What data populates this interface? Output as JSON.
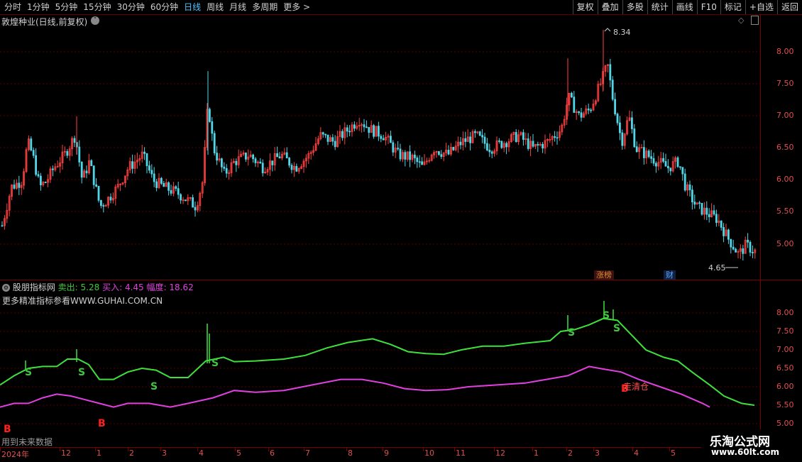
{
  "toolbar": {
    "periods": [
      "分时",
      "1分钟",
      "5分钟",
      "15分钟",
      "30分钟",
      "60分钟",
      "日线",
      "周线",
      "月线",
      "多周期",
      "更多 >"
    ],
    "active_period": "日线",
    "tools": [
      "复权",
      "叠加",
      "多股",
      "统计",
      "画线",
      "F10",
      "标记",
      "+自选",
      "返回"
    ]
  },
  "stock": {
    "title": "敦煌种业(日线,前复权)",
    "peak_label": "8.34",
    "low_label": "4.65",
    "price_axis": [
      "8.00",
      "7.50",
      "7.00",
      "6.50",
      "6.00",
      "5.50",
      "5.00"
    ],
    "badges": {
      "zhangbang": "涨榜",
      "cai": "财"
    }
  },
  "indicator": {
    "name": "股朋指标网",
    "sell_label": "卖出:",
    "sell_value": "5.28",
    "buy_label": "买入:",
    "buy_value": "4.45",
    "amp_label": "幅度:",
    "amp_value": "18.62",
    "note": "更多精准指标参看WWW.GUHAI.COM.CN",
    "axis": [
      "8.00",
      "7.50",
      "7.00",
      "6.50",
      "6.00",
      "5.50",
      "5.00"
    ],
    "signal_s": "S",
    "signal_b": "B",
    "clear_label": "走清仓",
    "future_note": "用到未来数据"
  },
  "date_axis": [
    "2024年",
    "12",
    "1",
    "2",
    "3",
    "4",
    "5",
    "6",
    "7",
    "8",
    "9",
    "10",
    "11",
    "12",
    "1",
    "2",
    "3",
    "4",
    "5"
  ],
  "watermark": {
    "line1": "乐淘公式网",
    "line2": "www.60lt.com"
  },
  "colors": {
    "up": "#ff4040",
    "down": "#4fd7e8",
    "sell_line": "#3ee03e",
    "buy_line": "#e040e0",
    "grid": "#7a0000"
  }
}
